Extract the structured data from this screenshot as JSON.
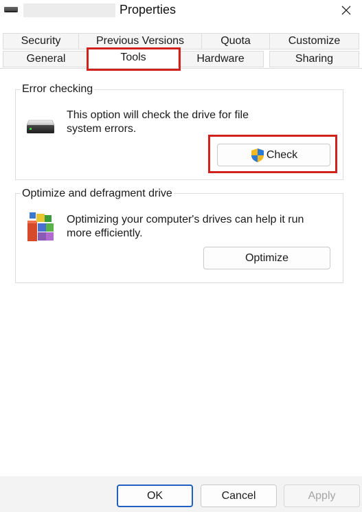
{
  "window": {
    "title": "Properties",
    "title_icon": "drive-icon",
    "close_icon": "close-icon"
  },
  "tabs": {
    "row1": [
      "Security",
      "Previous Versions",
      "Quota",
      "Customize"
    ],
    "row2": [
      "General",
      "Tools",
      "Hardware",
      "Sharing"
    ],
    "active": "Tools"
  },
  "error_checking": {
    "title": "Error checking",
    "description_line1": "This option will check the drive for file",
    "description_line2": "system errors.",
    "icon": "drive-icon",
    "button_icon": "shield-icon",
    "button_label": "Check"
  },
  "optimize": {
    "title": "Optimize and defragment drive",
    "description_line1": "Optimizing your computer's drives can help it run",
    "description_line2": "more efficiently.",
    "icon": "defrag-icon",
    "button_label": "Optimize"
  },
  "footer": {
    "ok_label": "OK",
    "cancel_label": "Cancel",
    "apply_label": "Apply"
  },
  "colors": {
    "highlight": "#d0211c",
    "accent": "#1f5fbf"
  }
}
